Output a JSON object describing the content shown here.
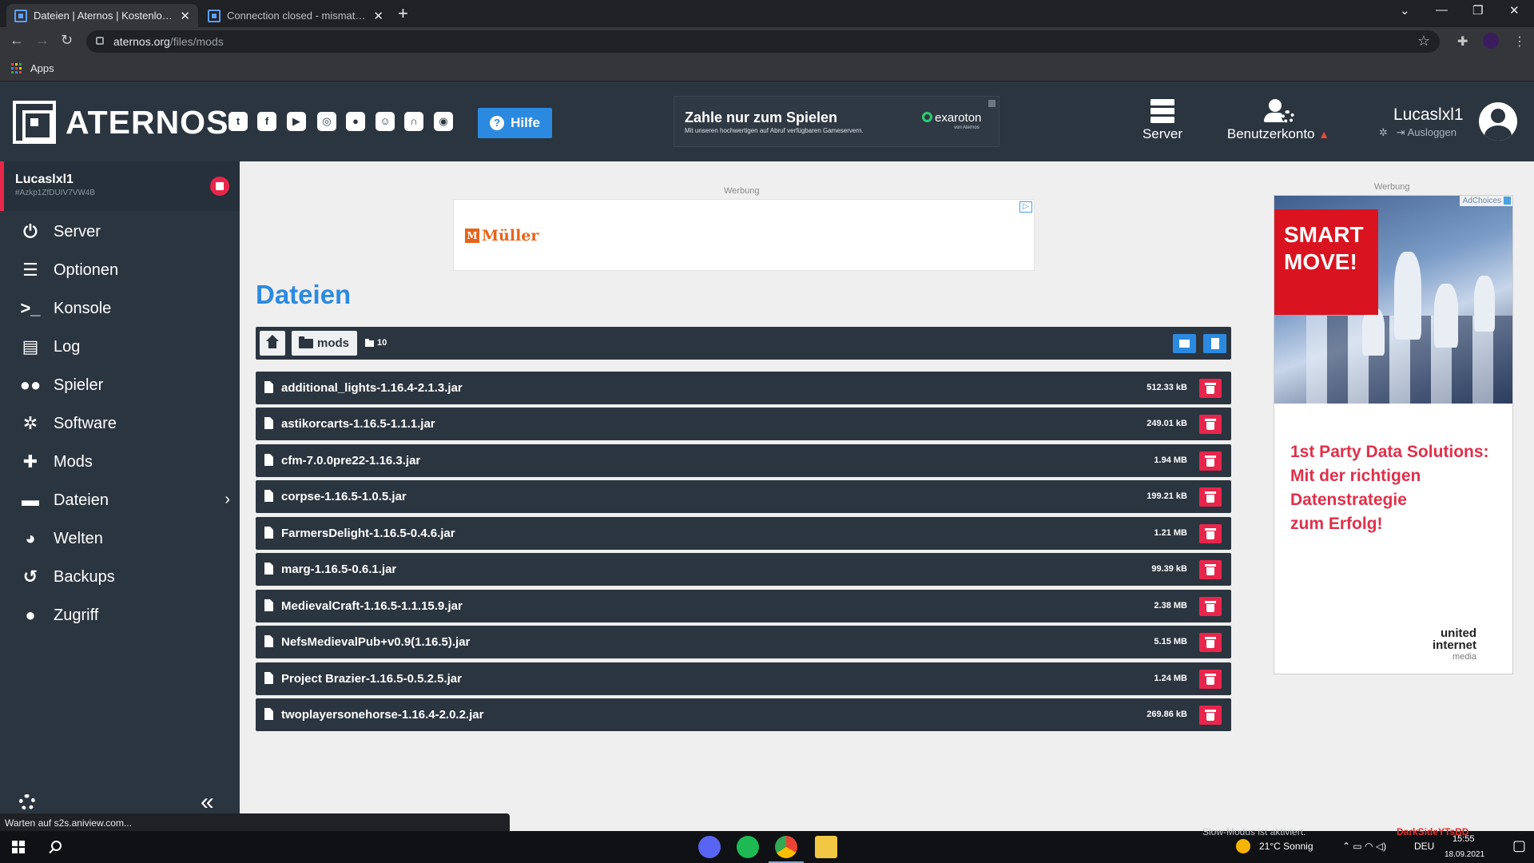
{
  "browser": {
    "tabs": [
      {
        "title": "Dateien | Aternos | Kostenlose Minecraft",
        "active": true
      },
      {
        "title": "Connection closed - mismatched",
        "active": false
      }
    ],
    "url_host": "aternos.org",
    "url_path": "/files/mods",
    "bookmarks_label": "Apps",
    "status_text": "Warten auf s2s.aniview.com..."
  },
  "header": {
    "logo_text": "ATERNOS",
    "social_icons": [
      "twitter-icon",
      "facebook-icon",
      "youtube-icon",
      "instagram-icon",
      "reddit-icon",
      "discord-icon",
      "support-headset-icon",
      "github-icon"
    ],
    "help_label": "Hilfe",
    "ad": {
      "headline": "Zahle nur zum Spielen",
      "subline": "Mit unseren hochwertigen auf Abruf verfügbaren Gameservern.",
      "brand": "exaroton",
      "brand_sub": "von Aternos"
    },
    "nav_server": "Server",
    "nav_account": "Benutzerkonto",
    "user_name": "Lucaslxl1",
    "logout_label": "Ausloggen"
  },
  "sidebar": {
    "server_name": "Lucaslxl1",
    "server_id": "#Azkp1ZfDUIV7VW4B",
    "items": [
      {
        "label": "Server",
        "icon": "power-icon"
      },
      {
        "label": "Optionen",
        "icon": "sliders-icon"
      },
      {
        "label": "Konsole",
        "icon": "terminal-icon"
      },
      {
        "label": "Log",
        "icon": "document-icon"
      },
      {
        "label": "Spieler",
        "icon": "users-icon"
      },
      {
        "label": "Software",
        "icon": "gears-icon"
      },
      {
        "label": "Mods",
        "icon": "puzzle-icon"
      },
      {
        "label": "Dateien",
        "icon": "folder-icon"
      },
      {
        "label": "Welten",
        "icon": "globe-icon"
      },
      {
        "label": "Backups",
        "icon": "history-icon"
      },
      {
        "label": "Zugriff",
        "icon": "user-lock-icon"
      }
    ]
  },
  "main": {
    "ad_label": "Werbung",
    "top_ad_brand": "Müller",
    "top_ad_brand_mark": "M",
    "title": "Dateien",
    "breadcrumb_folder": "mods",
    "file_count": "10",
    "files": [
      {
        "name": "additional_lights-1.16.4-2.1.3.jar",
        "size": "512.33 kB"
      },
      {
        "name": "astikorcarts-1.16.5-1.1.1.jar",
        "size": "249.01 kB"
      },
      {
        "name": "cfm-7.0.0pre22-1.16.3.jar",
        "size": "1.94 MB"
      },
      {
        "name": "corpse-1.16.5-1.0.5.jar",
        "size": "199.21 kB"
      },
      {
        "name": "FarmersDelight-1.16.5-0.4.6.jar",
        "size": "1.21 MB"
      },
      {
        "name": "marg-1.16.5-0.6.1.jar",
        "size": "99.39 kB"
      },
      {
        "name": "MedievalCraft-1.16.5-1.1.15.9.jar",
        "size": "2.38 MB"
      },
      {
        "name": "NefsMedievalPub+v0.9(1.16.5).jar",
        "size": "5.15 MB"
      },
      {
        "name": "Project Brazier-1.16.5-0.5.2.5.jar",
        "size": "1.24 MB"
      },
      {
        "name": "twoplayersonehorse-1.16.4-2.0.2.jar",
        "size": "269.86 kB"
      }
    ]
  },
  "side_ad": {
    "label": "Werbung",
    "adchoices": "AdChoices",
    "headline_1": "SMART",
    "headline_2": "MOVE!",
    "copy_1": "1st Party Data Solutions:",
    "copy_2": "Mit der richtigen",
    "copy_3": "Datenstrategie",
    "copy_4": "zum Erfolg!",
    "logo_1": "united",
    "logo_2": "internet",
    "logo_3": "media"
  },
  "taskbar": {
    "overlay_text": "Slow-Modus ist aktiviert.",
    "overlay_user": "DarkSideYTsBD",
    "weather": "21°C  Sonnig",
    "lang": "DEU",
    "time": "15:55",
    "date": "18.09.2021"
  },
  "colors": {
    "accent_blue": "#2b8ae0",
    "danger_red": "#e8264c",
    "panel_dark": "#2b3540"
  }
}
